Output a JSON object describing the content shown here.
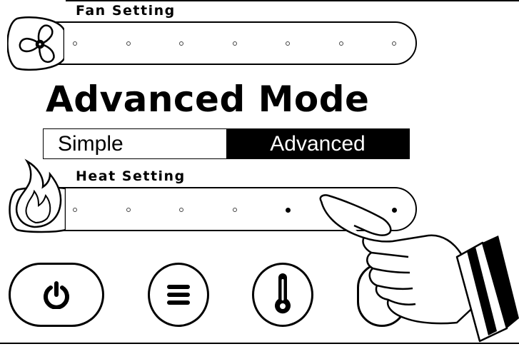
{
  "fan_setting": {
    "label": "Fan Setting",
    "icon": "fan-icon",
    "levels": 7,
    "active_levels": []
  },
  "mode": {
    "title": "Advanced Mode",
    "options": [
      "Simple",
      "Advanced"
    ],
    "selected": "Advanced"
  },
  "heat_setting": {
    "label": "Heat Setting",
    "icon": "flame-icon",
    "levels": 7,
    "active_levels": [
      5,
      7
    ]
  },
  "controls": [
    {
      "name": "power",
      "icon": "power-icon"
    },
    {
      "name": "menu",
      "icon": "menu-icon"
    },
    {
      "name": "temperature",
      "icon": "thermometer-icon"
    }
  ],
  "colors": {
    "foreground": "#000000",
    "background": "#ffffff"
  }
}
